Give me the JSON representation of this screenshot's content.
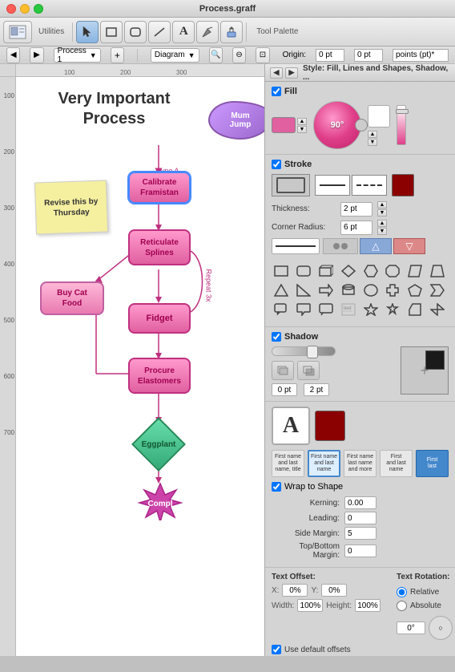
{
  "window": {
    "title": "Process.graff",
    "traffic_lights": [
      "close",
      "minimize",
      "maximize"
    ]
  },
  "toolbar": {
    "left_label": "Utilities",
    "right_label": "Tool Palette"
  },
  "info_bar": {
    "origin_label": "Origin:",
    "origin_x": "0 pt",
    "origin_y": "0 pt",
    "units": "points (pt)*"
  },
  "diagram": {
    "title_line1": "Very Important",
    "title_line2": "Process",
    "sticky_note": "Revise this by\nThursday",
    "type_label": "Type A",
    "repeat_label": "Repeat 3x",
    "shapes": [
      {
        "id": "mum_jump",
        "label": "Mum\nJump",
        "type": "cloud"
      },
      {
        "id": "calibrate",
        "label": "Calibrate\nFramistan",
        "type": "box",
        "selected": true
      },
      {
        "id": "reticulate",
        "label": "Reticulate\nSplines",
        "type": "box"
      },
      {
        "id": "buy_cat",
        "label": "Buy Cat Food",
        "type": "box_alt"
      },
      {
        "id": "fidget",
        "label": "Fidget",
        "type": "box"
      },
      {
        "id": "procure",
        "label": "Procure\nElastomers",
        "type": "box"
      },
      {
        "id": "eggplant",
        "label": "Eggplant",
        "type": "diamond"
      },
      {
        "id": "compl",
        "label": "Compl",
        "type": "spiky"
      }
    ]
  },
  "right_panel": {
    "title": "Style: Fill, Lines and Shapes, Shadow, ...",
    "fill_section": {
      "title": "Fill",
      "color": "#e060a0",
      "angle": "90°",
      "white_color": "#ffffff"
    },
    "stroke_section": {
      "title": "Stroke",
      "thickness_label": "Thickness:",
      "thickness_value": "2 pt",
      "corner_radius_label": "Corner Radius:",
      "corner_radius_value": "6 pt",
      "color": "#8b0000"
    },
    "shapes_grid": {
      "shapes": [
        "rect",
        "rounded-rect",
        "rect-3d",
        "diamond",
        "hexagon",
        "octagon",
        "parallelogram",
        "trapezoid",
        "triangle",
        "right-triangle",
        "arrow-right",
        "cylinder",
        "ellipse",
        "cross",
        "pentagon",
        "chevron",
        "callout",
        "star",
        "lightning",
        "gear",
        "document",
        "brace",
        "house",
        "shield"
      ]
    },
    "shadow_section": {
      "title": "Shadow",
      "offset1": "0 pt",
      "offset2": "2 pt"
    },
    "text_style": {
      "wrap_to_shape_label": "Wrap to Shape",
      "kerning_label": "Kerning:",
      "kerning_value": "0.00",
      "leading_label": "Leading:",
      "leading_value": "0",
      "side_margin_label": "Side Margin:",
      "side_margin_value": "5",
      "top_bottom_margin_label": "Top/Bottom Margin:",
      "top_bottom_margin_value": "0"
    },
    "text_offset": {
      "title": "Text Offset:",
      "x_label": "X:",
      "x_value": "0%",
      "y_label": "Y:",
      "y_value": "0%",
      "width_label": "Width:",
      "width_value": "100%",
      "height_label": "Height:",
      "height_value": "100%",
      "rotation_title": "Text Rotation:",
      "relative_label": "Relative",
      "absolute_label": "Absolute",
      "angle_value": "0°",
      "use_default_label": "Use default offsets"
    }
  }
}
